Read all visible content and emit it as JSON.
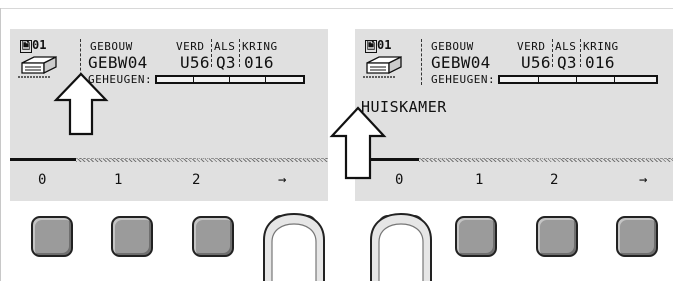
{
  "caption": "-- - - -- - -- -",
  "left_screen": {
    "memory_index": "01",
    "headers": {
      "gebouw": "GEBOUW",
      "verd": "VERD",
      "als": "ALS",
      "kring": "KRING"
    },
    "values": {
      "gebouw": "GEBW04",
      "verd": "U56",
      "als": "Q3",
      "kring": "016"
    },
    "memory_label": "GEHEUGEN:",
    "softkeys": [
      "0",
      "1",
      "2",
      "→"
    ]
  },
  "right_screen": {
    "memory_index": "01",
    "headers": {
      "gebouw": "GEBOUW",
      "verd": "VERD",
      "als": "ALS",
      "kring": "KRING"
    },
    "values": {
      "gebouw": "GEBW04",
      "verd": "U56",
      "als": "Q3",
      "kring": "016"
    },
    "memory_label": "GEHEUGEN:",
    "room_name": "HUISKAMER",
    "softkeys": [
      "0",
      "1",
      "2",
      "→"
    ]
  },
  "icons": {
    "memory": "memory-card-icon",
    "arrow": "up-arrow-icon",
    "finger": "finger-press-icon"
  },
  "colors": {
    "screen": "#e0e0e0",
    "key": "#9b9b9b",
    "ink": "#111111"
  }
}
